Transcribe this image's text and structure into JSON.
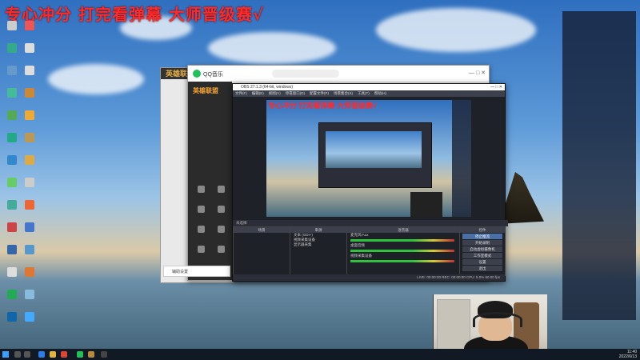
{
  "overlay": {
    "title": "专心冲分 打完看弹幕 大师晋级赛√"
  },
  "desktop_icons": [
    "",
    "",
    "",
    "",
    "",
    "",
    "",
    "",
    "",
    "",
    "",
    "",
    "",
    "",
    "",
    "",
    "",
    "",
    "",
    "",
    "",
    "",
    "",
    "",
    "",
    "",
    "",
    ""
  ],
  "qq_music": {
    "app_name": "QQ音乐",
    "search_placeholder": "",
    "side_brand": "英雄联盟",
    "sidebar_items": [
      "",
      "",
      "",
      "",
      "",
      "",
      "",
      ""
    ],
    "footer_label": "辅助设置"
  },
  "back_window": {
    "title": "英雄联盟"
  },
  "obs": {
    "title": "OBS 27.1.3 (64-bit, windows)",
    "menu": [
      "文件(F)",
      "编辑(E)",
      "视图(V)",
      "停靠窗口(D)",
      "配置文件(P)",
      "场景集合(S)",
      "工具(T)",
      "帮助(H)"
    ],
    "mini_overlay": "专心冲分 打完看弹幕 大师晋级赛√",
    "scene_bar_label": "未选择",
    "docks": {
      "scenes": {
        "header": "场景",
        "items": []
      },
      "sources": {
        "header": "来源",
        "items": [
          "文本 (GDI+)",
          "视频采集设备",
          "显示器采集"
        ]
      },
      "mixer": {
        "header": "混音器",
        "channels": [
          "麦克风/Aux",
          "桌面音频",
          "视频采集设备"
        ]
      },
      "controls": {
        "header": "控件",
        "buttons": [
          "停止推流",
          "开始录制",
          "启动虚拟摄像机",
          "工作室模式",
          "设置",
          "退出"
        ]
      }
    },
    "status": "LIVE: 00:00:00  REC: 00:00:00  CPU: 5.0%  60.00 fps"
  },
  "chat": {
    "header": "",
    "lines": [
      "",
      "",
      "",
      "",
      "",
      "",
      "",
      "",
      "",
      "",
      "",
      "",
      ""
    ],
    "footer": ""
  },
  "taskbar": {
    "time": "11:40",
    "date": "2022/6/13"
  }
}
